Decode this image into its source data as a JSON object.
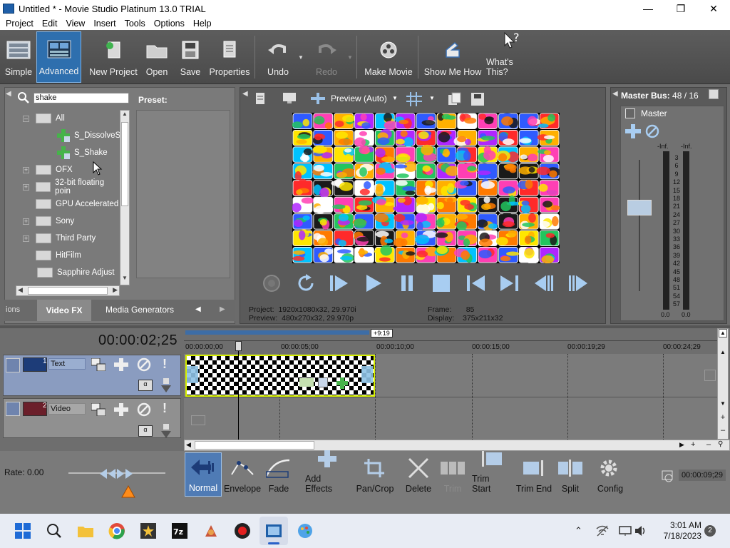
{
  "window": {
    "title": "Untitled * - Movie Studio Platinum 13.0 TRIAL"
  },
  "menu": [
    "Project",
    "Edit",
    "View",
    "Insert",
    "Tools",
    "Options",
    "Help"
  ],
  "toolbar": {
    "simple": "Simple",
    "advanced": "Advanced",
    "new_project": "New Project",
    "open": "Open",
    "save": "Save",
    "properties": "Properties",
    "undo": "Undo",
    "redo": "Redo",
    "make_movie": "Make Movie",
    "show_me_how": "Show Me How",
    "whats_this": "What's This?"
  },
  "fx_panel": {
    "search_value": "shake",
    "preset_label": "Preset:",
    "tree": [
      {
        "label": "All",
        "icon": "folder-icon"
      },
      {
        "label": "S_DissolveSh",
        "icon": "fx-plugin-icon"
      },
      {
        "label": "S_Shake",
        "icon": "fx-plugin-icon"
      },
      {
        "label": "OFX",
        "icon": "folder-icon"
      },
      {
        "label": "32-bit floating poin",
        "icon": "folder-icon"
      },
      {
        "label": "GPU Accelerated",
        "icon": "folder-icon"
      },
      {
        "label": "Sony",
        "icon": "folder-icon"
      },
      {
        "label": "Third Party",
        "icon": "folder-icon"
      },
      {
        "label": "HitFilm",
        "icon": "folder-icon"
      },
      {
        "label": "Sapphire Adjust",
        "icon": "folder-icon"
      }
    ],
    "tabs": [
      "ions",
      "Video FX",
      "Media Generators"
    ]
  },
  "preview": {
    "mode": "Preview (Auto)",
    "project_label": "Project:",
    "project_value": "1920x1080x32, 29.970i",
    "preview_label": "Preview:",
    "preview_value": "480x270x32, 29.970p",
    "frame_label": "Frame:",
    "frame_value": "85",
    "display_label": "Display:",
    "display_value": "375x211x32"
  },
  "master_bus": {
    "title": "Master Bus:",
    "value": "48 / 16",
    "master_label": "Master",
    "inf_left": "-Inf.",
    "inf_right": "-Inf.",
    "scale": [
      "3",
      "6",
      "9",
      "12",
      "15",
      "18",
      "21",
      "24",
      "27",
      "30",
      "33",
      "36",
      "39",
      "42",
      "45",
      "48",
      "51",
      "54",
      "57"
    ],
    "bottom_left": "0.0",
    "bottom_right": "0.0"
  },
  "timeline": {
    "timecode": "00:00:02;25",
    "ruler": [
      "00:00:00;00",
      "00:00:05;00",
      "00:00:10;00",
      "00:00:15;00",
      "00:00:19;29",
      "00:00:24;29"
    ],
    "marker": "+9:19",
    "tracks": [
      {
        "number": "1",
        "name": "Text"
      },
      {
        "number": "2",
        "name": "Video"
      }
    ]
  },
  "bottom": {
    "rate": "Rate: 0.00",
    "normal": "Normal",
    "envelope": "Envelope",
    "fade": "Fade",
    "add_effects": "Add Effects",
    "pan_crop": "Pan/Crop",
    "delete": "Delete",
    "trim": "Trim",
    "trim_start": "Trim Start",
    "trim_end": "Trim End",
    "split": "Split",
    "config": "Config",
    "end_time": "00:00:09;29"
  },
  "taskbar": {
    "time": "3:01 AM",
    "date": "7/18/2023",
    "notif_count": "2"
  },
  "colors": {
    "toolbar_bg": "#4f4f4f",
    "panel_bg": "#7a7a7a",
    "track_hdr": "#8a9cc0",
    "clip_border": "#d6f000",
    "taskbar_bg": "#e8ecf4"
  }
}
